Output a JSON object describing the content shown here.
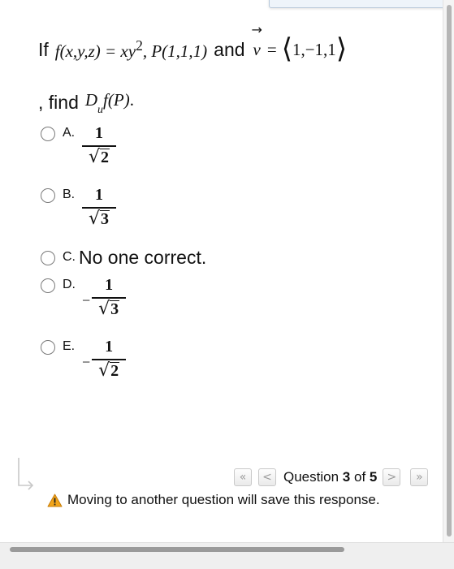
{
  "question": {
    "prefix": "If",
    "function_lhs": "f(x,y,z) = xy",
    "function_exp": "2",
    "point": ", P(1,1,1)",
    "conjunction": "and",
    "vector_name": "v",
    "vector_arrow": "→",
    "equals": "=",
    "vector_value": "1,−1,1",
    "line2_prefix": ", find",
    "derivative_D": "D",
    "derivative_sub": "u",
    "derivative_arg": "f(P)",
    "period": "."
  },
  "options": [
    {
      "letter": "A.",
      "negative": "",
      "numerator": "1",
      "radicand": "2"
    },
    {
      "letter": "B.",
      "negative": "",
      "numerator": "1",
      "radicand": "3"
    },
    {
      "letter": "C.",
      "text": "No one correct."
    },
    {
      "letter": "D.",
      "negative": "−",
      "numerator": "1",
      "radicand": "3"
    },
    {
      "letter": "E.",
      "negative": "−",
      "numerator": "1",
      "radicand": "2"
    }
  ],
  "navigation": {
    "first_icon": "«",
    "prev_icon": "<",
    "label_prefix": "Question",
    "current": "3",
    "of_text": "of",
    "total": "5",
    "next_icon": ">",
    "last_icon": "»"
  },
  "warning": {
    "text": "Moving to another question will save this response.",
    "color": "#f2a51a"
  },
  "sqrt_symbol": "√"
}
